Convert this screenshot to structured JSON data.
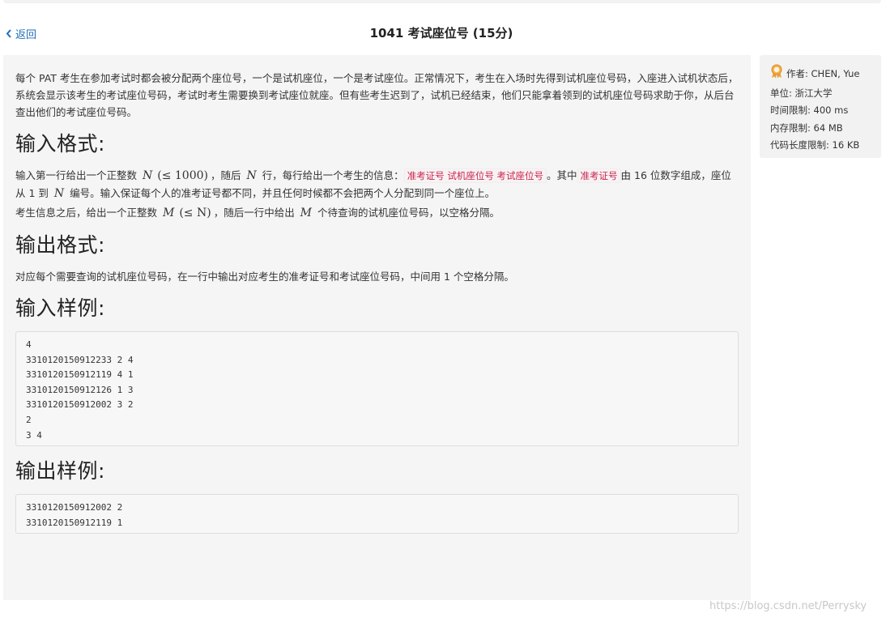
{
  "nav": {
    "back_label": "返回",
    "back_chevron": "‹"
  },
  "problem": {
    "title": "1041 考试座位号 (15分)",
    "description": "每个 PAT 考生在参加考试时都会被分配两个座位号，一个是试机座位，一个是考试座位。正常情况下，考生在入场时先得到试机座位号码，入座进入试机状态后，系统会显示该考生的考试座位号码，考试时考生需要换到考试座位就座。但有些考生迟到了，试机已经结束，他们只能拿着领到的试机座位号码求助于你，从后台查出他们的考试座位号码。",
    "input_heading": "输入格式:",
    "input_p1": {
      "t1": "输入第一行给出一个正整数 ",
      "m1": "N",
      "m2": "(≤ 1000)",
      "t2": "，随后 ",
      "m3": "N",
      "t3": " 行，每行给出一个考生的信息：",
      "code1": "准考证号 试机座位号 考试座位号",
      "t4": "。其中",
      "code2": "准考证号",
      "t5": "由 16 位数字组成，座位从 1 到 ",
      "m4": "N",
      "t6": " 编号。输入保证每个人的准考证号都不同，并且任何时候都不会把两个人分配到同一个座位上。"
    },
    "input_p2": {
      "t1": "考生信息之后，给出一个正整数 ",
      "m1": "M",
      "m2": "(≤ N)",
      "t2": "，随后一行中给出 ",
      "m3": "M",
      "t3": " 个待查询的试机座位号码，以空格分隔。"
    },
    "output_heading": "输出格式:",
    "output_p": "对应每个需要查询的试机座位号码，在一行中输出对应考生的准考证号和考试座位号码，中间用 1 个空格分隔。",
    "sample_input_heading": "输入样例:",
    "sample_input": "4\n3310120150912233 2 4\n3310120150912119 4 1\n3310120150912126 1 3\n3310120150912002 3 2\n2\n3 4",
    "sample_output_heading": "输出样例:",
    "sample_output": "3310120150912002 2\n3310120150912119 1"
  },
  "meta": {
    "author": "作者: CHEN, Yue",
    "unit": "单位: 浙江大学",
    "time_limit": "时间限制: 400 ms",
    "memory_limit": "内存限制: 64 MB",
    "code_limit": "代码长度限制: 16 KB"
  },
  "watermark": "https://blog.csdn.net/Perrysky",
  "colors": {
    "link": "#1f6fb8",
    "inline_code": "#c7254e",
    "panel": "#f5f5f5",
    "medal": "#e8a33d"
  }
}
